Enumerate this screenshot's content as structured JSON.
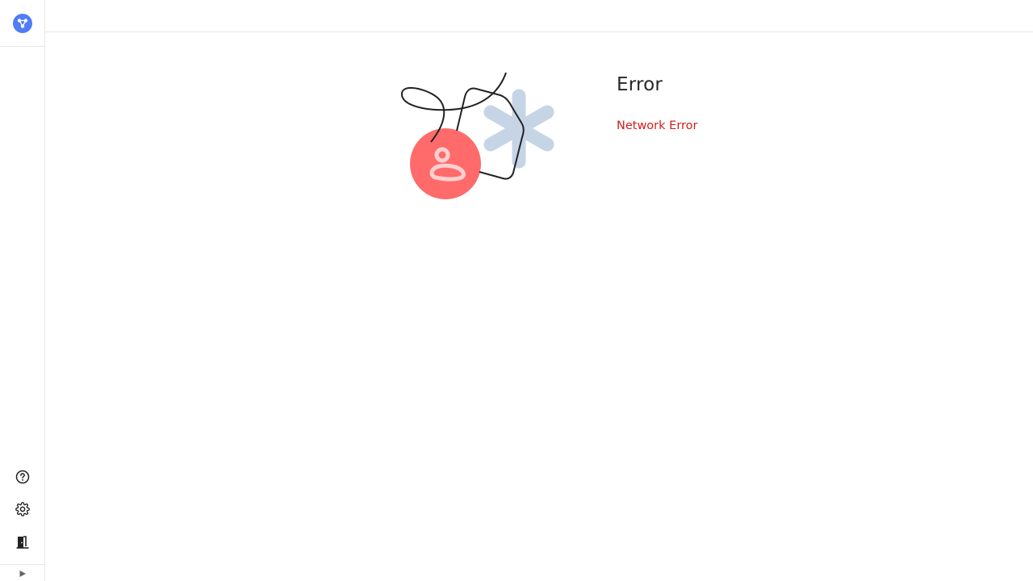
{
  "brand": {
    "logo_icon": "network-nodes-icon",
    "accent": "#4f7cf7"
  },
  "sidebar": {
    "bottom_items": [
      {
        "name": "help",
        "icon": "help-circle-icon"
      },
      {
        "name": "settings",
        "icon": "gear-icon"
      },
      {
        "name": "logout",
        "icon": "door-exit-icon"
      }
    ],
    "collapse_icon": "play-triangle-icon"
  },
  "error": {
    "title": "Error",
    "message": "Network Error",
    "message_color": "#d21c1c"
  },
  "illustration": {
    "icon": "user-error-illustration",
    "circle_color": "#ff6b6b",
    "asterisk_color": "#c5d5e6"
  }
}
